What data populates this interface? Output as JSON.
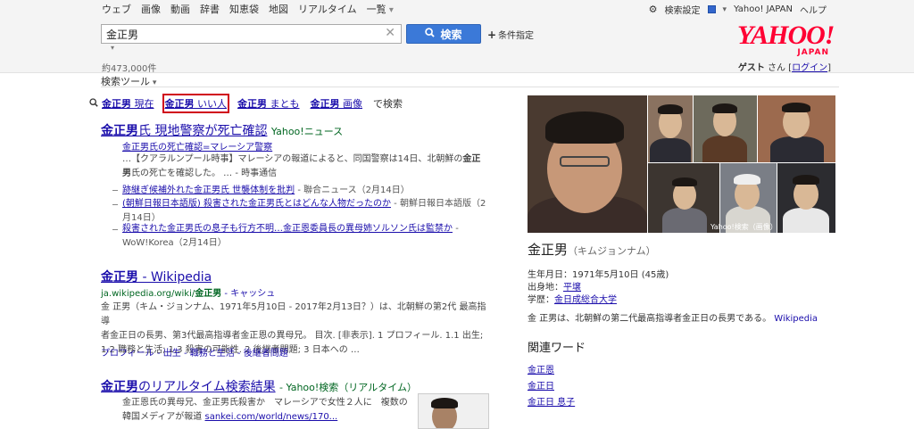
{
  "nav": {
    "items": [
      "ウェブ",
      "画像",
      "動画",
      "辞書",
      "知恵袋",
      "地図",
      "リアルタイム"
    ],
    "more": "一覧"
  },
  "top_right": {
    "settings": "検索設定",
    "yahoo_japan": "Yahoo! JAPAN",
    "help": "ヘルプ"
  },
  "logo": {
    "main": "YAHOO!",
    "sub": "JAPAN"
  },
  "search": {
    "query": "金正男",
    "button": "検索",
    "conditions": "条件指定"
  },
  "result_count": "約473,000件",
  "guest": {
    "name": "ゲスト",
    "suffix": " さん [",
    "login": "ログイン",
    "close": "]"
  },
  "tools": "検索ツール",
  "related": {
    "items": [
      {
        "bold": "金正男",
        "rest": " 現在"
      },
      {
        "bold": "金正男",
        "rest": " いい人"
      },
      {
        "bold": "金正男",
        "rest": " まとも"
      },
      {
        "bold": "金正男",
        "rest": " 画像"
      }
    ],
    "suffix": "で検索"
  },
  "results": [
    {
      "title_bold": "金正男",
      "title_rest": "氏 現地警察が死亡確認",
      "source": "Yahoo!ニュース",
      "sub_headline": "金正男氏の死亡確認=マレーシア警察",
      "snippet1": "…【クアラルンプール時事】マレーシアの報道によると、同国警察は14日、北朝鮮の",
      "snippet1_bold": "金正",
      "snippet2_bold": "男",
      "snippet2": "氏の死亡を確認した。 … - 時事通信",
      "links": [
        {
          "text": "跡継ぎ候補外れた金正男氏 世襲体制を批判",
          "src": "- 聯合ニュース（2月14日）"
        },
        {
          "text": "(朝鮮日報日本語版) 殺害された金正男氏とはどんな人物だったのか",
          "src": "- 朝鮮日報日本語版（2月14日）"
        },
        {
          "text": "殺害された金正男氏の息子も行方不明…金正恩委員長の異母姉ソルソン氏は監禁か",
          "src": "- WoW!Korea（2月14日）"
        }
      ]
    },
    {
      "title_bold": "金正男",
      "title_rest": " - Wikipedia",
      "url": "ja.wikipedia.org/wiki/",
      "url_bold": "金正男",
      "cache": "- キャッシュ",
      "snippet_lines": [
        "金 正男（キム・ジョンナム、1971年5月10日 - 2017年2月13日？）は、北朝鮮の第2代 最高指導",
        "者金正日の長男、第3代最高指導者金正恩の異母兄。 目次. [非表示]. 1 プロフィール. 1.1 出生;",
        "1.2 職務と生活; 1.3 殺害の可能性. 2 後継者問題; 3 日本への …"
      ],
      "sitelinks": "プロフィール - 出生 - 職務と生活 - 後継者問題"
    },
    {
      "title_bold": "金正男",
      "title_rest": "のリアルタイム検索結果",
      "source": "- Yahoo!検索（リアルタイム）",
      "snippet1": "金正恩氏の異母兄、金正男氏殺害か　マレーシアで女性２人に　複数の",
      "snippet2": "韓国メディアが報道",
      "snippet2_link": "sankei.com/world/news/170..."
    }
  ],
  "knowledge": {
    "caption": "Yahoo!検索（画像）",
    "name": "金正男",
    "reading": "（キムジョンナム）",
    "birth_label": "生年月日：",
    "birth": "1971年5月10日 (45歳)",
    "origin_label": "出身地：",
    "origin": "平壌",
    "school_label": "学歴：",
    "school": "金日成総合大学",
    "desc": "金 正男は、北朝鮮の第二代最高指導者金正日の長男である。",
    "desc_src": "Wikipedia",
    "related_heading": "関連ワード",
    "related": [
      "金正恩",
      "金正日",
      "金正日 息子"
    ]
  },
  "colors": {
    "accent": "#3b79d8",
    "link": "#1a0dab",
    "green": "#006621",
    "brand": "#ff0033",
    "highlight": "#d0021b"
  }
}
